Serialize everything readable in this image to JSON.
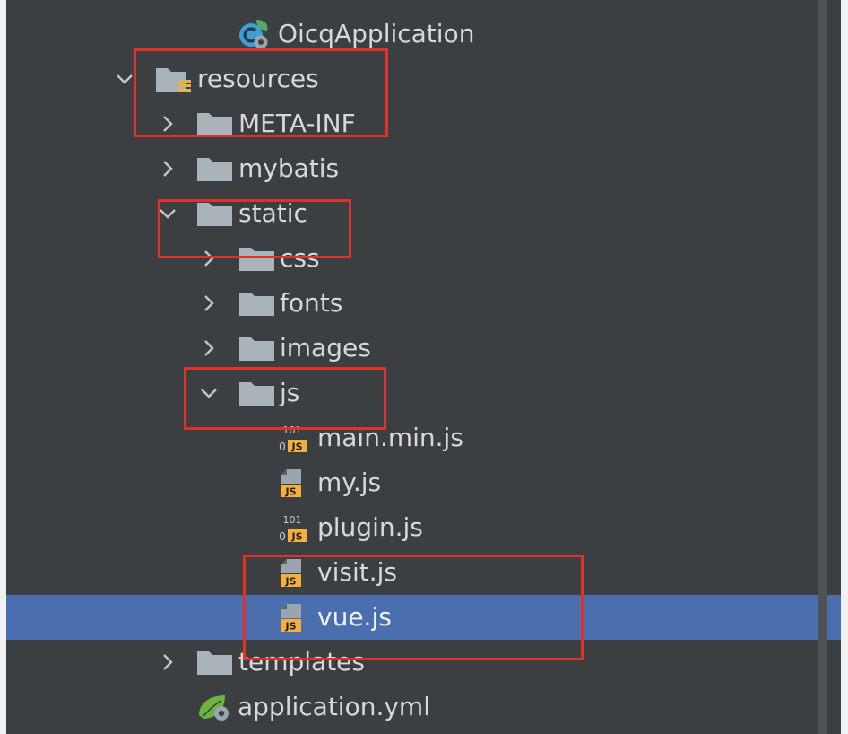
{
  "tree": {
    "app_class": {
      "label": "OicqApplication",
      "icon": "spring-boot-class-icon"
    },
    "resources": {
      "label": "resources",
      "expanded": true,
      "icon": "resources-root-folder-icon",
      "children": [
        {
          "label": "META-INF",
          "expanded": false,
          "icon": "folder-icon"
        },
        {
          "label": "mybatis",
          "expanded": false,
          "icon": "folder-icon"
        },
        {
          "label": "static",
          "expanded": true,
          "icon": "folder-icon",
          "children": [
            {
              "label": "css",
              "expanded": false,
              "icon": "folder-icon"
            },
            {
              "label": "fonts",
              "expanded": false,
              "icon": "folder-icon"
            },
            {
              "label": "images",
              "expanded": false,
              "icon": "folder-icon"
            },
            {
              "label": "js",
              "expanded": true,
              "icon": "folder-icon",
              "children": [
                {
                  "label": "main.min.js",
                  "icon": "minified-js-file-icon"
                },
                {
                  "label": "my.js",
                  "icon": "js-file-icon"
                },
                {
                  "label": "plugin.js",
                  "icon": "minified-js-file-icon"
                },
                {
                  "label": "visit.js",
                  "icon": "js-file-icon"
                },
                {
                  "label": "vue.js",
                  "icon": "js-file-icon",
                  "selected": true
                }
              ]
            }
          ]
        },
        {
          "label": "templates",
          "expanded": false,
          "icon": "folder-icon"
        },
        {
          "label": "application.yml",
          "icon": "spring-yaml-file-icon"
        }
      ]
    }
  },
  "icon_glyphs": {
    "js_badge": "JS",
    "min_bits": "101",
    "min_zero": "0"
  },
  "colors": {
    "background": "#3c3f41",
    "selection": "#4b6eaf",
    "text": "#d6d9dc",
    "annotation": "#e4302a",
    "folder": "#aab3ba",
    "js_badge": "#f4af3d",
    "spring_green": "#6db33f"
  }
}
